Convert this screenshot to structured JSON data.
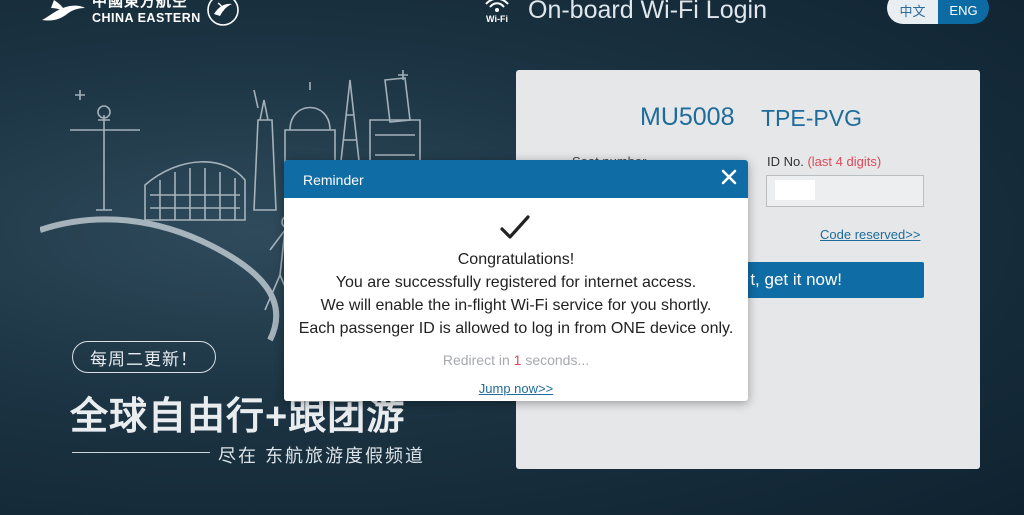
{
  "header": {
    "brand_cn": "中國東方航空",
    "brand_en": "CHINA EASTERN",
    "title": "On-board Wi-Fi Login",
    "wifi_label": "Wi-Fi",
    "lang": {
      "zh": "中文",
      "en": "ENG",
      "active": "ENG"
    }
  },
  "promo": {
    "badge": "每周二更新！",
    "title": "全球自由行+跟团游",
    "subtitle": "尽在 东航旅游度假频道"
  },
  "login": {
    "flight": "MU5008",
    "route": "TPE-PVG",
    "seat_label": "Seat number",
    "id_label": "ID No.",
    "id_hint": "(last 4 digits)",
    "code_reserved": "Code reserved>>",
    "get_button": "t, get it now!"
  },
  "modal": {
    "title": "Reminder",
    "lines": [
      "Congratulations!",
      "You are successfully registered for internet access.",
      "We will enable the in-flight Wi-Fi service for you shortly.",
      "Each passenger ID is allowed to log in from ONE device only."
    ],
    "redirect_prefix": "Redirect in",
    "redirect_count": "1",
    "redirect_suffix": "seconds...",
    "jump_now": "Jump now>>"
  },
  "colors": {
    "brand_blue": "#0f6ca5",
    "accent_red": "#e0485a",
    "background": "#1b3342"
  },
  "icons": [
    "swallow-logo-icon",
    "seal-icon",
    "wifi-icon",
    "close-icon",
    "checkmark-icon"
  ]
}
